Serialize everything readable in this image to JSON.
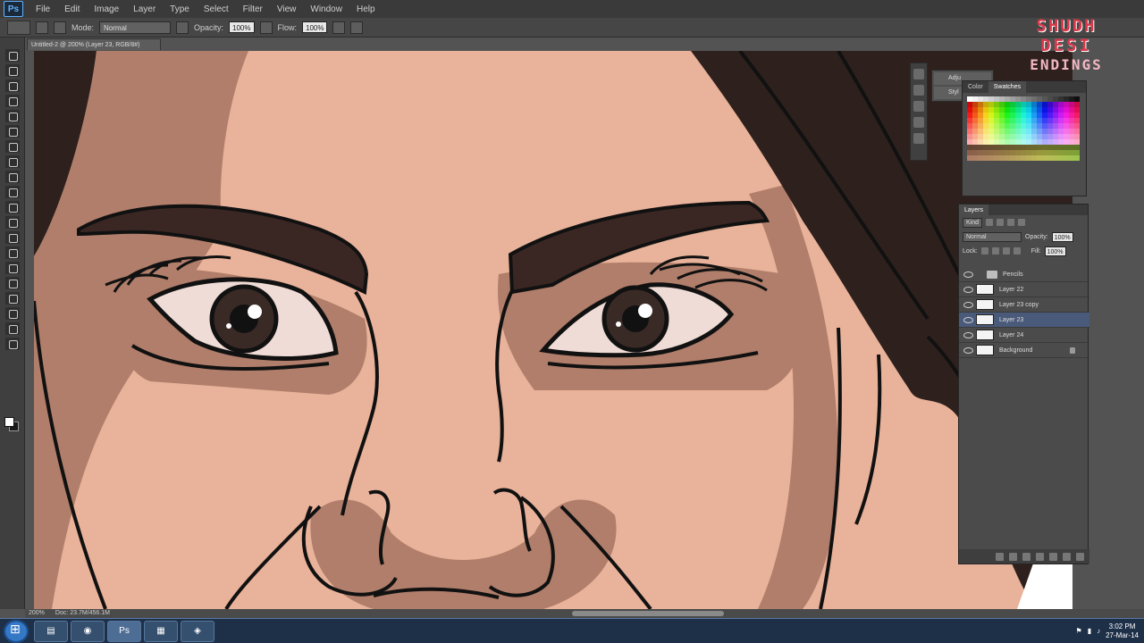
{
  "app": {
    "logo": "Ps"
  },
  "menu": [
    "File",
    "Edit",
    "Image",
    "Layer",
    "Type",
    "Select",
    "Filter",
    "View",
    "Window",
    "Help"
  ],
  "options_bar": {
    "mode_label": "Mode:",
    "mode_value": "Normal",
    "opacity_label": "Opacity:",
    "opacity_value": "100%",
    "flow_label": "Flow:",
    "flow_value": "100%"
  },
  "document": {
    "tab_title": "Untitled-2 @ 200% (Layer 23, RGB/8#)"
  },
  "status": {
    "zoom": "200%",
    "doc_size": "Doc: 23.7M/456.1M"
  },
  "swatches_panel": {
    "tabs": [
      "Color",
      "Swatches"
    ]
  },
  "layers_panel": {
    "tab": "Layers",
    "kind_label": "Kind",
    "blend_mode": "Normal",
    "opacity_label": "Opacity:",
    "opacity_value": "100%",
    "lock_label": "Lock:",
    "fill_label": "Fill:",
    "fill_value": "100%",
    "layers": [
      {
        "name": "Pencils",
        "type": "group"
      },
      {
        "name": "Layer 22",
        "type": "layer"
      },
      {
        "name": "Layer 23 copy",
        "type": "layer"
      },
      {
        "name": "Layer 23",
        "type": "layer",
        "selected": true
      },
      {
        "name": "Layer 24",
        "type": "layer"
      },
      {
        "name": "Background",
        "type": "background"
      }
    ]
  },
  "mini_panel": {
    "rows": [
      "Adju",
      "Styl"
    ]
  },
  "watermark": {
    "line1": "SHUDH",
    "line2": "DESI",
    "line3": "ENDINGS"
  },
  "taskbar": {
    "apps": [
      "explorer-icon",
      "chrome-icon",
      "photoshop-icon",
      "folder-icon",
      "misc-icon"
    ],
    "time": "3:02 PM",
    "date": "27-Mar-14"
  },
  "colors": {
    "skin": "#e9b29a",
    "shadow": "#b07e6a",
    "hair": "#2e211d",
    "line": "#111111"
  }
}
